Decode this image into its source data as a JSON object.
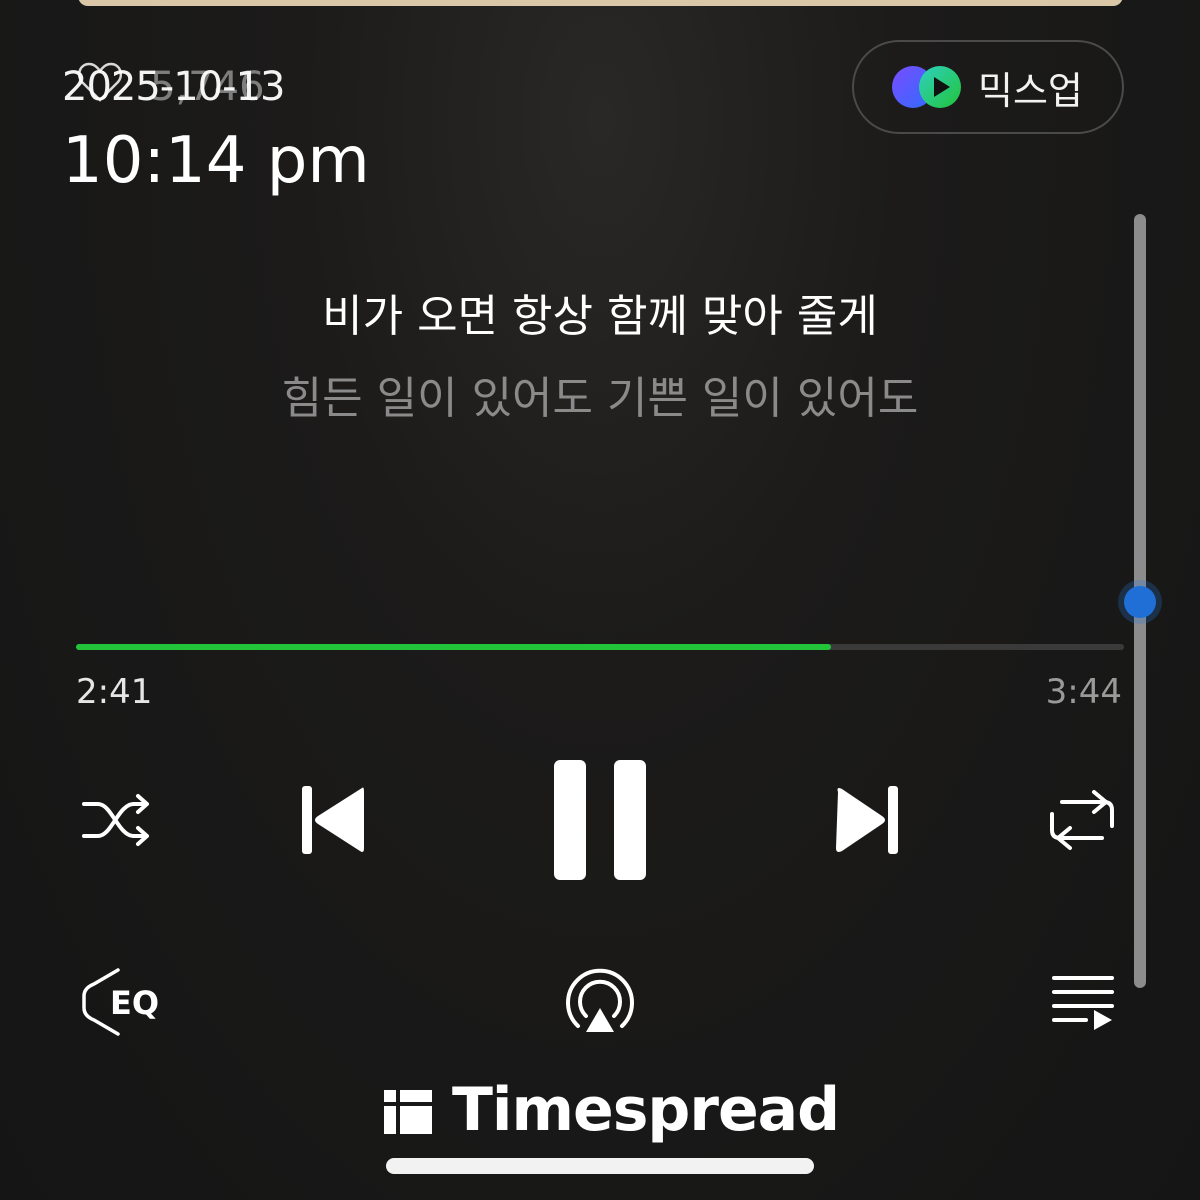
{
  "overlay": {
    "date": "2025-10-13",
    "like_count": "5,746",
    "time": "10:14 pm"
  },
  "mixup": {
    "label": "믹스업"
  },
  "lyrics": {
    "current": "비가 오면 항상 함께 맞아 줄게",
    "next": "힘든 일이 있어도 기쁜 일이 있어도"
  },
  "player": {
    "elapsed": "2:41",
    "total": "3:44",
    "progress": 0.72
  },
  "controls": {
    "shuffle": "shuffle-icon",
    "previous": "previous-icon",
    "pause": "pause-icon",
    "next": "next-icon",
    "repeat": "repeat-icon"
  },
  "bottom": {
    "eq_label": "EQ",
    "airplay": "airplay-icon",
    "playlist": "playlist-icon"
  },
  "watermark": {
    "text": "Timespread"
  },
  "colors": {
    "accent": "#22c43a",
    "scroll_knob": "#1f6fd6",
    "background": "#151515"
  }
}
